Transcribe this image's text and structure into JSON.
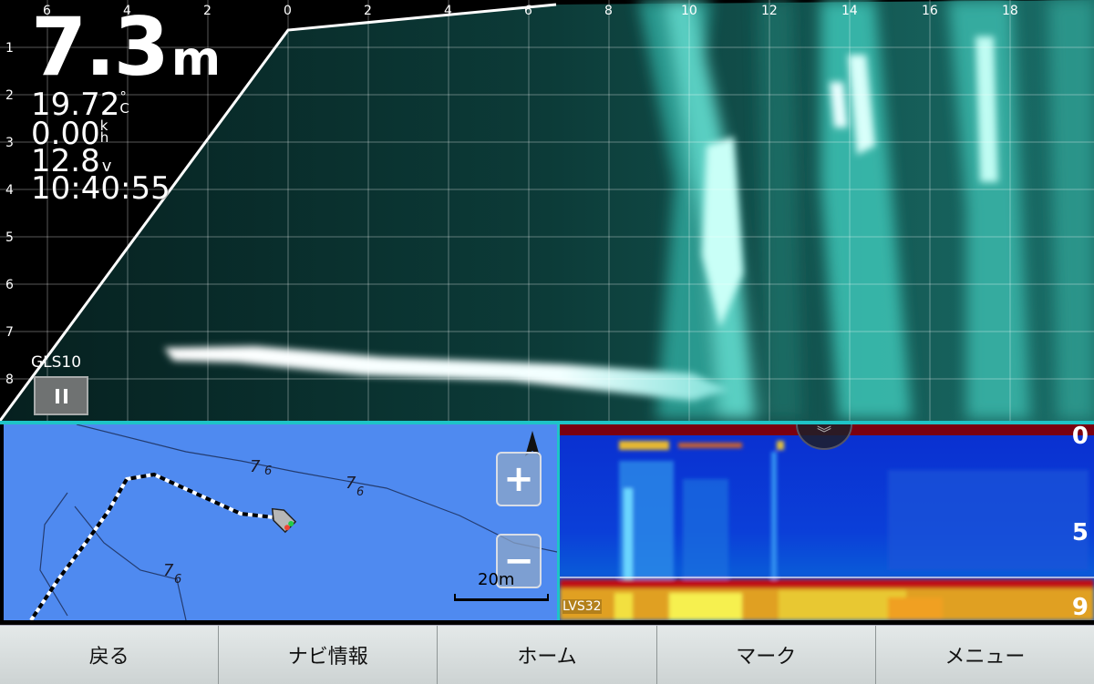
{
  "sonar": {
    "depth_value": "7.3",
    "depth_unit": "m",
    "temperature": "19.72",
    "temperature_unit_top": "°",
    "temperature_unit_bottom": "C",
    "speed": "0.00",
    "speed_unit_top": "k",
    "speed_unit_bottom": "h",
    "voltage": "12.8",
    "voltage_unit": "v",
    "time": "10:40:55",
    "top_ticks": [
      "6",
      "4",
      "2",
      "0",
      "2",
      "4",
      "6",
      "8",
      "10",
      "12",
      "14",
      "16",
      "18"
    ],
    "left_ticks": [
      "1",
      "2",
      "3",
      "4",
      "5",
      "6",
      "7",
      "8"
    ],
    "transducer_label": "GLS10",
    "pause_icon": "pause-icon",
    "colors": {
      "echo": "#2fd6c8",
      "bottom": "#ffffff",
      "background": "#000000"
    }
  },
  "map": {
    "contour_labels": [
      "7",
      "6",
      "7",
      "6",
      "7",
      "6"
    ],
    "scale_label": "20m",
    "zoom_in_label": "+",
    "zoom_out_label": "−",
    "north_icon": "north-arrow-icon",
    "boat_icon": "boat-icon",
    "colors": {
      "water": "#4f8af0"
    }
  },
  "echo": {
    "scale_top": "0",
    "scale_mid": "5",
    "scale_bottom": "9",
    "transducer_label": "LVS32",
    "collapse_icon": "chevron-double-down-icon"
  },
  "toolbar": {
    "back": "戻る",
    "navi_info": "ナビ情報",
    "home": "ホーム",
    "mark": "マーク",
    "menu": "メニュー"
  }
}
